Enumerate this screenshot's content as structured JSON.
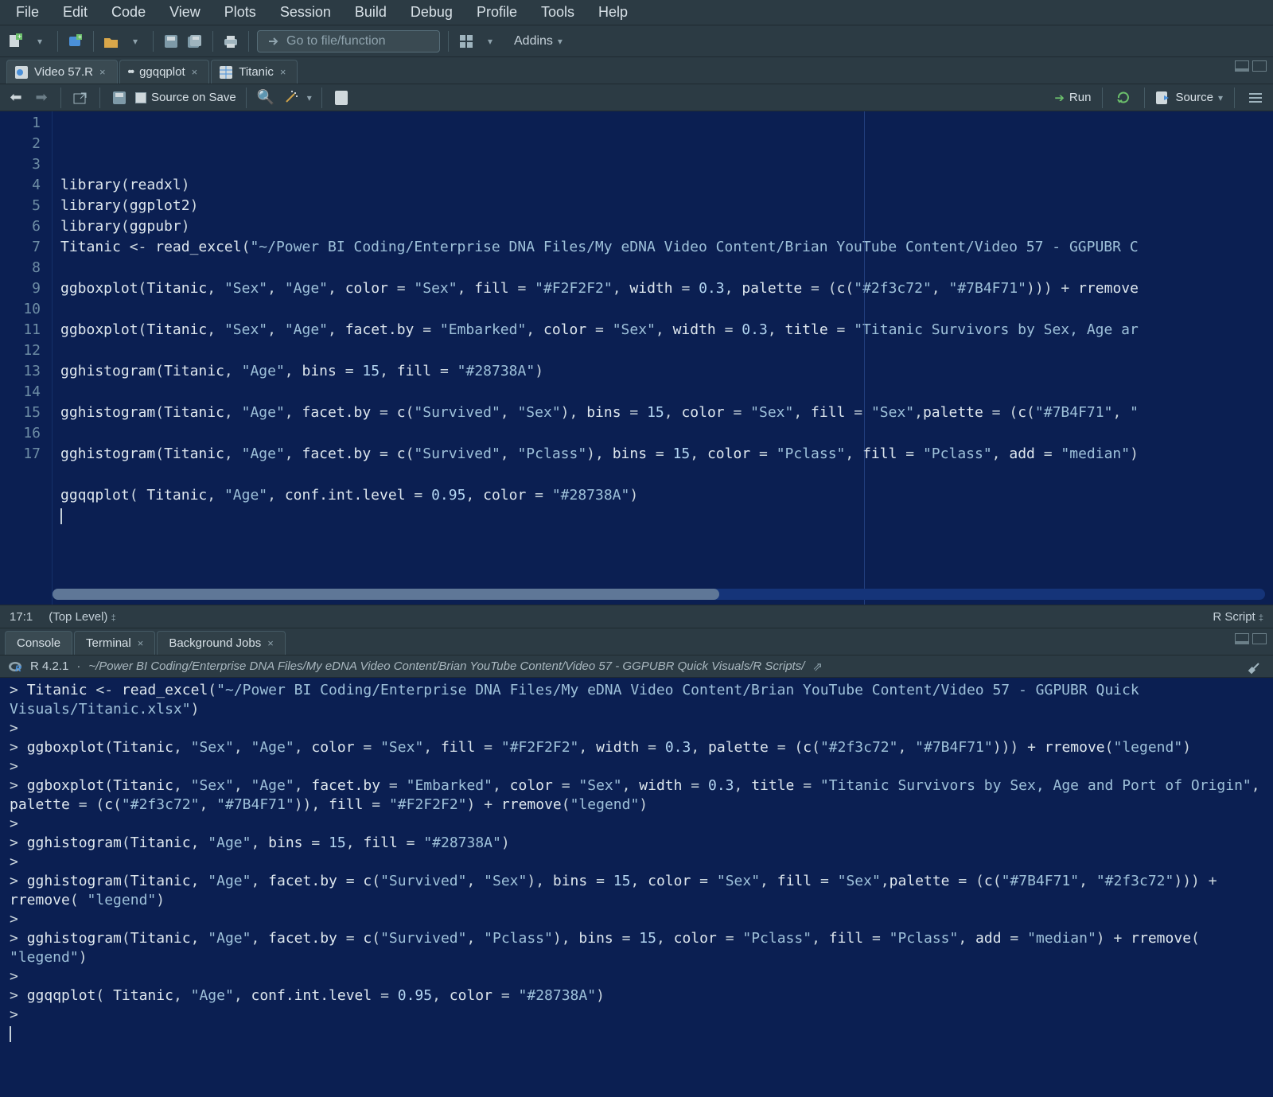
{
  "menu": [
    "File",
    "Edit",
    "Code",
    "View",
    "Plots",
    "Session",
    "Build",
    "Debug",
    "Profile",
    "Tools",
    "Help"
  ],
  "toolbar": {
    "goto_placeholder": "Go to file/function",
    "addins_label": "Addins"
  },
  "file_tabs": [
    {
      "label": "Video 57.R",
      "dirty": false,
      "close": "×",
      "icon": "r"
    },
    {
      "label": "ggqqplot",
      "dirty": true,
      "close": "×",
      "icon": "dots"
    },
    {
      "label": "Titanic",
      "dirty": false,
      "close": "×",
      "icon": "table"
    }
  ],
  "source_toolbar": {
    "source_on_save": "Source on Save",
    "run_label": "Run",
    "source_label": "Source"
  },
  "editor": {
    "lines": [
      "library(readxl)",
      "library(ggplot2)",
      "library(ggpubr)",
      "Titanic <- read_excel(\"~/Power BI Coding/Enterprise DNA Files/My eDNA Video Content/Brian YouTube Content/Video 57 - GGPUBR C",
      "",
      "ggboxplot(Titanic, \"Sex\", \"Age\", color = \"Sex\", fill = \"#F2F2F2\", width = 0.3, palette = (c(\"#2f3c72\", \"#7B4F71\"))) + rremove",
      "",
      "ggboxplot(Titanic, \"Sex\", \"Age\", facet.by = \"Embarked\", color = \"Sex\", width = 0.3, title = \"Titanic Survivors by Sex, Age ar",
      "",
      "gghistogram(Titanic, \"Age\", bins = 15, fill = \"#28738A\")",
      "",
      "gghistogram(Titanic, \"Age\", facet.by = c(\"Survived\", \"Sex\"), bins = 15, color = \"Sex\", fill = \"Sex\",palette = (c(\"#7B4F71\", \"",
      "",
      "gghistogram(Titanic, \"Age\", facet.by = c(\"Survived\", \"Pclass\"), bins = 15, color = \"Pclass\", fill = \"Pclass\", add = \"median\")",
      "",
      "ggqqplot( Titanic, \"Age\", conf.int.level = 0.95, color = \"#28738A\")",
      ""
    ],
    "line_count": 17
  },
  "status": {
    "cursor": "17:1",
    "scope": "(Top Level)",
    "filetype": "R Script"
  },
  "console_tabs": [
    {
      "label": "Console",
      "close": ""
    },
    {
      "label": "Terminal",
      "close": "×"
    },
    {
      "label": "Background Jobs",
      "close": "×"
    }
  ],
  "console_header": {
    "r_version": "R 4.2.1",
    "path": "~/Power BI Coding/Enterprise DNA Files/My eDNA Video Content/Brian YouTube Content/Video 57 - GGPUBR Quick Visuals/R Scripts/"
  },
  "console_lines": [
    "> Titanic <- read_excel(\"~/Power BI Coding/Enterprise DNA Files/My eDNA Video Content/Brian YouTube Content/Video 57 - GGPUBR Quick Visuals/Titanic.xlsx\")",
    "> ",
    "> ggboxplot(Titanic, \"Sex\", \"Age\", color = \"Sex\", fill = \"#F2F2F2\", width = 0.3, palette = (c(\"#2f3c72\", \"#7B4F71\"))) + rremove(\"legend\")",
    "> ",
    "> ggboxplot(Titanic, \"Sex\", \"Age\", facet.by = \"Embarked\", color = \"Sex\", width = 0.3, title = \"Titanic Survivors by Sex, Age and Port of Origin\", palette = (c(\"#2f3c72\", \"#7B4F71\")), fill = \"#F2F2F2\") + rremove(\"legend\")",
    "> ",
    "> gghistogram(Titanic, \"Age\", bins = 15, fill = \"#28738A\")",
    "> ",
    "> gghistogram(Titanic, \"Age\", facet.by = c(\"Survived\", \"Sex\"), bins = 15, color = \"Sex\", fill = \"Sex\",palette = (c(\"#7B4F71\", \"#2f3c72\"))) + rremove( \"legend\")",
    "> ",
    "> gghistogram(Titanic, \"Age\", facet.by = c(\"Survived\", \"Pclass\"), bins = 15, color = \"Pclass\", fill = \"Pclass\", add = \"median\") + rremove( \"legend\")",
    "> ",
    "> ggqqplot( Titanic, \"Age\", conf.int.level = 0.95, color = \"#28738A\")",
    "> "
  ]
}
